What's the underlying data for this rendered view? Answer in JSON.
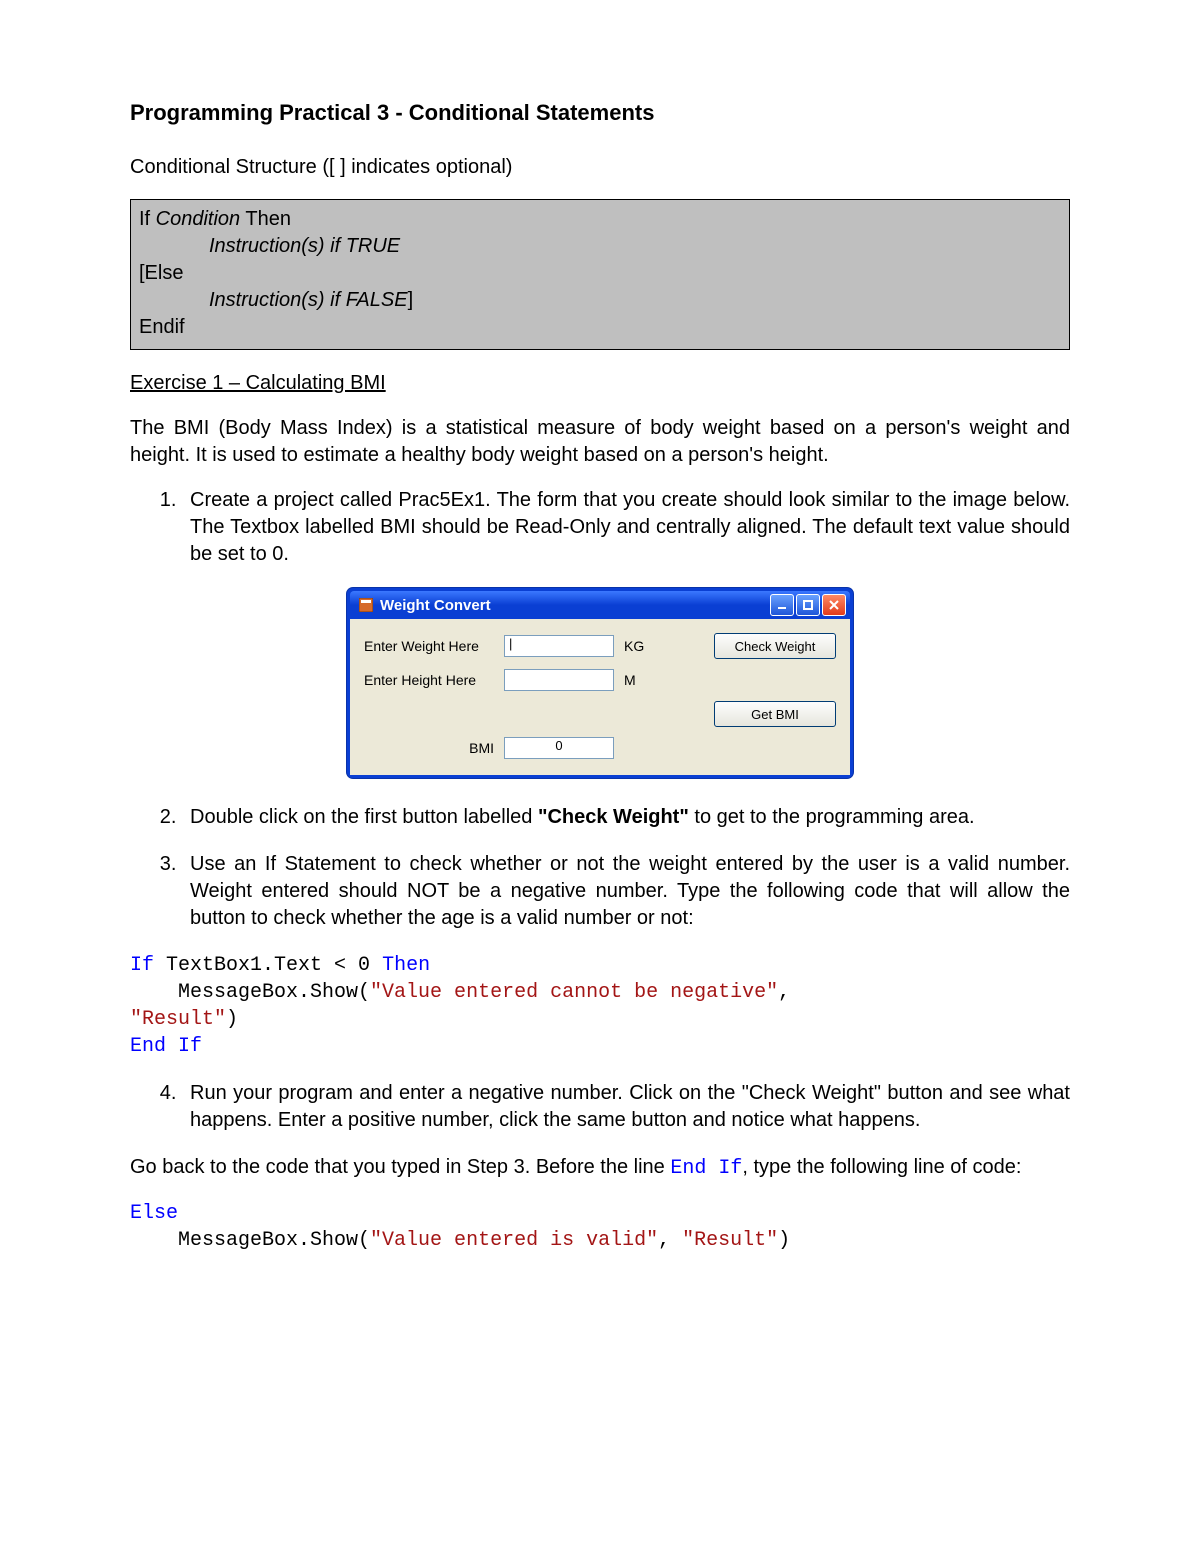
{
  "title": "Programming Practical 3 - Conditional Statements",
  "intro": "Conditional Structure ([ ] indicates optional)",
  "syntax": {
    "l1a": "If ",
    "l1b": "Condition",
    "l1c": " Then",
    "l2": "Instruction(s) if TRUE",
    "l3": "[Else",
    "l4a": "Instruction(s) if FALSE",
    "l4b": "]",
    "l5": "Endif"
  },
  "ex1_head": "Exercise 1 – Calculating BMI",
  "ex1_desc": "The BMI (Body Mass Index) is a statistical measure of body weight based on a person's weight and height.  It is used to estimate a healthy body weight based on a person's height.",
  "steps": {
    "s1": "Create a project called Prac5Ex1.  The form that you create should look similar to the image below.  The Textbox labelled BMI should be Read-Only and centrally aligned.  The default text value should be set to 0.",
    "s2a": "Double click on the first button labelled ",
    "s2b": "\"Check Weight\"",
    "s2c": " to get to the programming area.",
    "s3": "Use an If Statement to check whether or not the weight entered by the user is a valid number.  Weight entered should NOT be a negative number.  Type the following code that will allow the button to check whether the age is a valid number or not:",
    "s4": "Run your program and enter a negative number.  Click on the \"Check Weight\" button and see what happens.  Enter a positive number, click the same button and notice what happens."
  },
  "between_a": "Go back to the code that you typed in Step 3.  Before the line ",
  "between_b": "End If",
  "between_c": ", type the following line of code:",
  "winform": {
    "title": "Weight Convert",
    "lbl_weight": "Enter Weight Here",
    "lbl_height": "Enter Height Here",
    "lbl_bmi": "BMI",
    "unit_kg": "KG",
    "unit_m": "M",
    "btn_check": "Check Weight",
    "btn_getbmi": "Get BMI",
    "bmi_value": "0"
  },
  "code1": {
    "kw_if": "If",
    "t1": " TextBox1.Text < 0 ",
    "kw_then": "Then",
    "t2": "    MessageBox.Show(",
    "s1": "\"Value entered cannot be negative\"",
    "t3": ",",
    "s2": "\"Result\"",
    "t4": ")",
    "kw_end": "End If"
  },
  "code2": {
    "kw_else": "Else",
    "t1": "    MessageBox.Show(",
    "s1": "\"Value entered is valid\"",
    "t2": ", ",
    "s2": "\"Result\"",
    "t3": ")"
  }
}
